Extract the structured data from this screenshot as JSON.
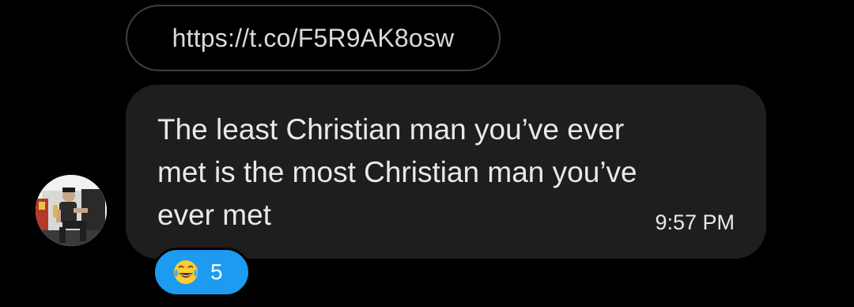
{
  "link": {
    "url_text": "https://t.co/F5R9AK8osw"
  },
  "message": {
    "text": "The least Christian man you’ve ever\nmet is the most Christian man you’ve\never met",
    "time": "9:57 PM"
  },
  "avatar": {
    "icon": "user-photo-avatar"
  },
  "reaction": {
    "icon": "face-with-tears-of-joy-icon",
    "count": "5",
    "color": "#1d9bf0"
  },
  "theme": {
    "background": "#000000",
    "bubble": "#1e1e1f",
    "text": "#e7e9ea"
  }
}
